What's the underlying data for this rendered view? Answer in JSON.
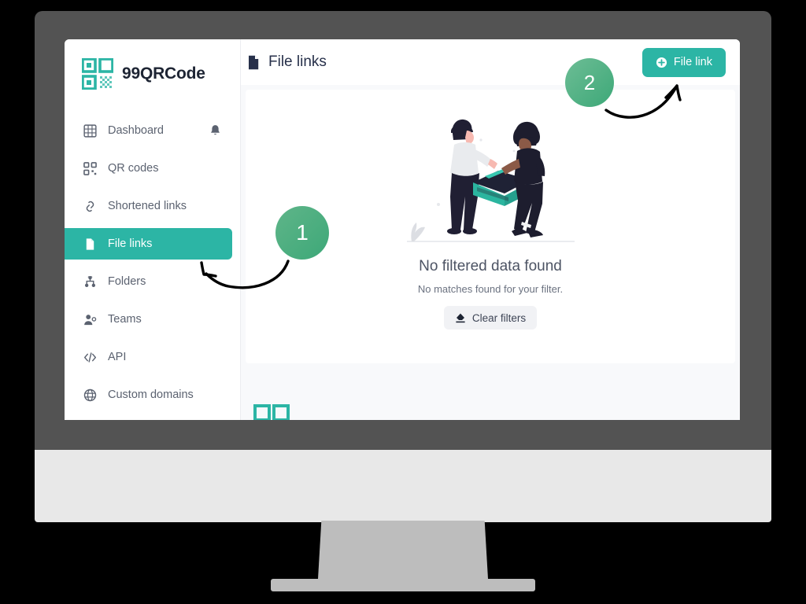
{
  "brand": {
    "name": "99QRCode",
    "logo_icon": "qr-code-icon",
    "accent_color": "#2cb5a5"
  },
  "sidebar": {
    "items": [
      {
        "label": "Dashboard",
        "icon": "grid-icon",
        "active": false,
        "trailing_icon": "bell-icon"
      },
      {
        "label": "QR codes",
        "icon": "qr-small-icon",
        "active": false
      },
      {
        "label": "Shortened links",
        "icon": "link-chain-icon",
        "active": false
      },
      {
        "label": "File links",
        "icon": "file-icon",
        "active": true
      },
      {
        "label": "Folders",
        "icon": "folder-tree-icon",
        "active": false
      },
      {
        "label": "Teams",
        "icon": "users-icon",
        "active": false
      },
      {
        "label": "API",
        "icon": "code-icon",
        "active": false
      },
      {
        "label": "Custom domains",
        "icon": "globe-icon",
        "active": false
      }
    ]
  },
  "header": {
    "title": "File links",
    "title_icon": "file-icon",
    "primary_button": {
      "label": "File link",
      "icon": "plus-circle-icon",
      "color": "#2cb5a5"
    }
  },
  "empty_state": {
    "illustration": "two-people-handing-box-illustration",
    "title": "No filtered data found",
    "subtitle": "No matches found for your filter.",
    "action": {
      "label": "Clear filters",
      "icon": "eraser-icon"
    }
  },
  "footer": {
    "mark_icon": "qr-squares-watermark"
  },
  "annotations": [
    {
      "number": "1",
      "target": "sidebar-item-file-links",
      "color": "#3da878"
    },
    {
      "number": "2",
      "target": "file-link-button",
      "color": "#3da878"
    }
  ]
}
